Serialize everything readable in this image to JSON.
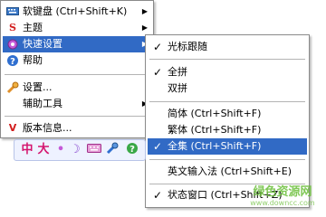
{
  "main_menu": {
    "items": [
      {
        "label": "软键盘 (Ctrl+Shift+K)",
        "icon": "keyboard-icon",
        "has_submenu": true
      },
      {
        "label": "主题",
        "icon": "theme-icon",
        "has_submenu": true
      },
      {
        "label": "快速设置",
        "icon": "gear-icon",
        "has_submenu": true,
        "highlighted": true
      },
      {
        "label": "帮助",
        "icon": "help-icon",
        "has_submenu": false
      },
      {
        "label": "设置...",
        "icon": "wrench-icon",
        "has_submenu": false
      },
      {
        "label": "辅助工具",
        "icon": "",
        "has_submenu": true
      },
      {
        "label": "版本信息...",
        "icon": "version-icon",
        "has_submenu": false
      }
    ]
  },
  "sub_menu": {
    "items": [
      {
        "label": "光标跟随",
        "checked": true
      },
      {
        "label": "全拼",
        "checked": true
      },
      {
        "label": "双拼",
        "checked": false
      },
      {
        "label": "简体 (Ctrl+Shift+F)",
        "checked": false
      },
      {
        "label": "繁体 (Ctrl+Shift+F)",
        "checked": false
      },
      {
        "label": "全集 (Ctrl+Shift+F)",
        "checked": true,
        "highlighted": true
      },
      {
        "label": "英文输入法 (Ctrl+Shift+E)",
        "checked": false
      },
      {
        "label": "状态窗口 (Ctrl+Shift+Z)",
        "checked": true
      }
    ]
  },
  "toolbar": {
    "mode_label": "中",
    "width_label": "大",
    "punct_label": "•",
    "moon_label": "☽"
  },
  "watermark": {
    "text_cn": "绿色资源网",
    "text_url": "www.downcc.com"
  },
  "colors": {
    "highlight": "#316ac5",
    "toolbar_mode": "#d4146e",
    "watermark_green": "#6bbf3a"
  }
}
